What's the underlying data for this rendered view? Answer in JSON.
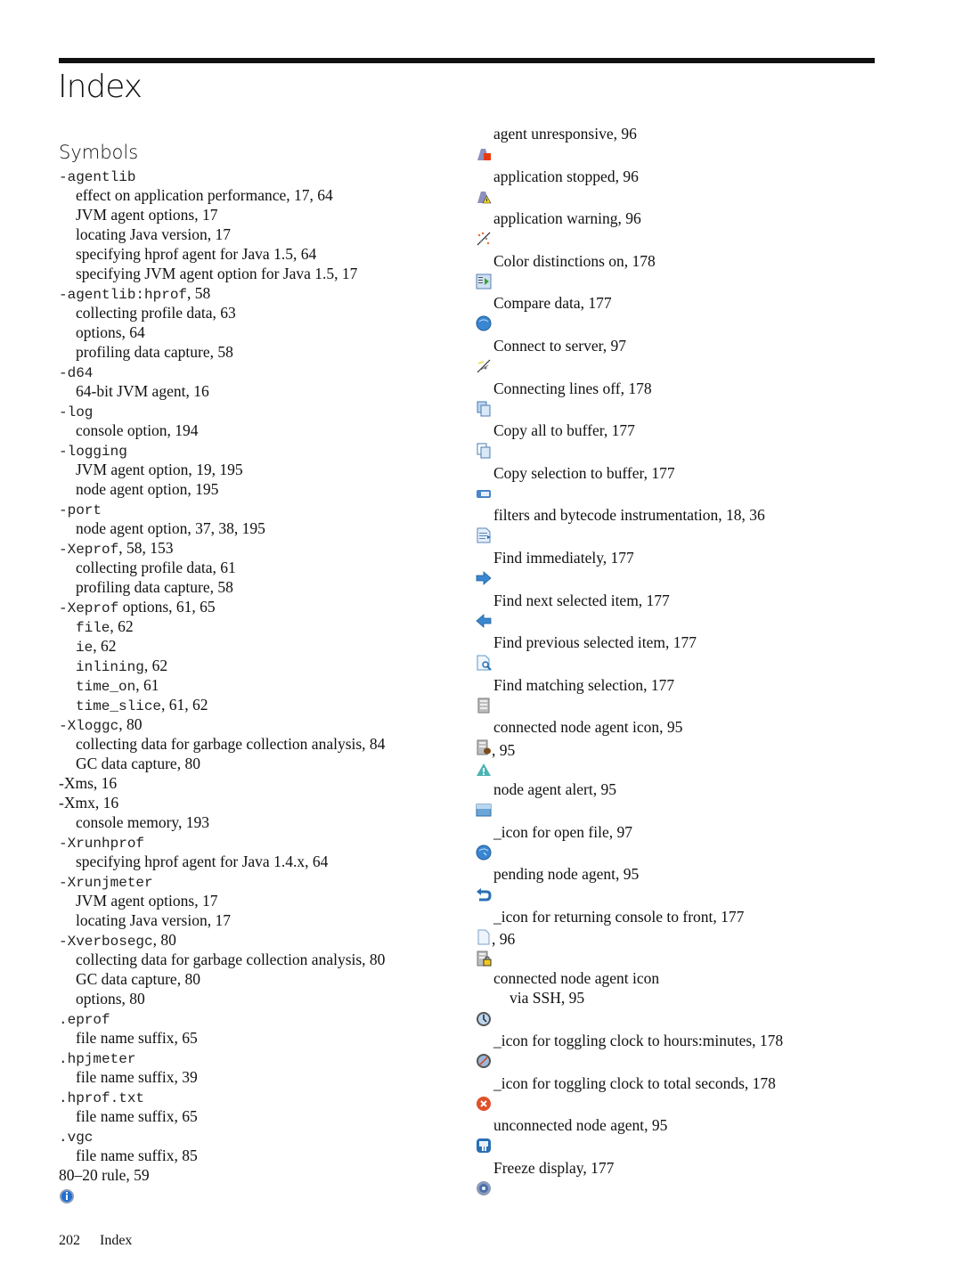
{
  "page": {
    "title": "Index",
    "footer": {
      "page_number": "202",
      "section": "Index"
    }
  },
  "left_column": {
    "section_heading": "Symbols",
    "entries": [
      {
        "term": "-agentlib",
        "mono": true,
        "refs": "",
        "level": 0
      },
      {
        "term": "effect on application performance, 17, 64",
        "level": 1
      },
      {
        "term": "JVM agent options, 17",
        "level": 1
      },
      {
        "term": "locating Java version, 17",
        "level": 1
      },
      {
        "term": "specifying hprof agent for Java 1.5, 64",
        "level": 1
      },
      {
        "term": "specifying JVM agent option for Java 1.5, 17",
        "level": 1
      },
      {
        "term": "-agentlib:hprof",
        "mono": true,
        "refs": ", 58",
        "level": 0
      },
      {
        "term": "collecting profile data, 63",
        "level": 1
      },
      {
        "term": "options, 64",
        "level": 1
      },
      {
        "term": "profiling data capture, 58",
        "level": 1
      },
      {
        "term": "-d64",
        "mono": true,
        "refs": "",
        "level": 0
      },
      {
        "term": "64-bit JVM agent, 16",
        "level": 1
      },
      {
        "term": "-log",
        "mono": true,
        "refs": "",
        "level": 0
      },
      {
        "term": "console option, 194",
        "level": 1
      },
      {
        "term": "-logging",
        "mono": true,
        "refs": "",
        "level": 0
      },
      {
        "term": "JVM agent option, 19, 195",
        "level": 1
      },
      {
        "term": "node agent option, 195",
        "level": 1
      },
      {
        "term": "-port",
        "mono": true,
        "refs": "",
        "level": 0
      },
      {
        "term": "node agent option, 37, 38, 195",
        "level": 1
      },
      {
        "term": "-Xeprof",
        "mono": true,
        "refs": ", 58, 153",
        "level": 0
      },
      {
        "term": "collecting profile data, 61",
        "level": 1
      },
      {
        "term": "profiling data capture, 58",
        "level": 1
      },
      {
        "term": "-Xeprof",
        "mono": true,
        "refs": " options, 61, 65",
        "level": 0
      },
      {
        "term": "file",
        "mono": true,
        "refs": ", 62",
        "level": 1
      },
      {
        "term": "ie",
        "mono": true,
        "refs": ", 62",
        "level": 1
      },
      {
        "term": "inlining",
        "mono": true,
        "refs": ", 62",
        "level": 1
      },
      {
        "term": "time_on",
        "mono": true,
        "refs": ", 61",
        "level": 1
      },
      {
        "term": "time_slice",
        "mono": true,
        "refs": ", 61, 62",
        "level": 1
      },
      {
        "term": "-Xloggc",
        "mono": true,
        "refs": ", 80",
        "level": 0
      },
      {
        "term": "collecting data for garbage collection analysis, 84",
        "level": 1
      },
      {
        "term": "GC data capture, 80",
        "level": 1
      },
      {
        "term": "-Xms, 16",
        "level": 0
      },
      {
        "term": "-Xmx, 16",
        "level": 0
      },
      {
        "term": "console memory, 193",
        "level": 1
      },
      {
        "term": "-Xrunhprof",
        "mono": true,
        "refs": "",
        "level": 0
      },
      {
        "term": "specifying hprof agent for Java 1.4.x, 64",
        "level": 1
      },
      {
        "term": "-Xrunjmeter",
        "mono": true,
        "refs": "",
        "level": 0
      },
      {
        "term": "JVM agent options, 17",
        "level": 1
      },
      {
        "term": "locating Java version, 17",
        "level": 1
      },
      {
        "term": "-Xverbosegc",
        "mono": true,
        "refs": ", 80",
        "level": 0
      },
      {
        "term": "collecting data for garbage collection analysis, 80",
        "level": 1
      },
      {
        "term": "GC data capture, 80",
        "level": 1
      },
      {
        "term": "options, 80",
        "level": 1
      },
      {
        "term": ".eprof",
        "mono": true,
        "refs": "",
        "level": 0
      },
      {
        "term": "file name suffix, 65",
        "level": 1
      },
      {
        "term": ".hpjmeter",
        "mono": true,
        "refs": "",
        "level": 0
      },
      {
        "term": "file name suffix, 39",
        "level": 1
      },
      {
        "term": ".hprof.txt",
        "mono": true,
        "refs": "",
        "level": 0
      },
      {
        "term": "file name suffix, 65",
        "level": 1
      },
      {
        "term": ".vgc",
        "mono": true,
        "refs": "",
        "level": 0
      },
      {
        "term": "file name suffix, 85",
        "level": 1
      },
      {
        "term": "80–20 rule, 59",
        "level": 0
      }
    ],
    "trailing_icon": "gear-info-icon"
  },
  "right_column": {
    "items": [
      {
        "text": "agent unresponsive, 96",
        "icon": "agent-stopped-icon"
      },
      {
        "text": "application stopped, 96",
        "icon": "application-warning-icon"
      },
      {
        "text": "application warning, 96",
        "icon": "color-distinctions-icon"
      },
      {
        "text": "Color distinctions on, 178",
        "icon": "compare-data-icon"
      },
      {
        "text": "Compare data, 177",
        "icon": "globe-icon"
      },
      {
        "text": "Connect to server, 97",
        "icon": "connecting-lines-icon"
      },
      {
        "text": "Connecting lines off, 178",
        "icon": "copy-all-icon"
      },
      {
        "text": "Copy all to buffer, 177",
        "icon": "copy-selection-icon"
      },
      {
        "text": "Copy selection to buffer, 177",
        "icon": "filter-icon"
      },
      {
        "text": "filters and bytecode instrumentation, 18, 36",
        "icon": "find-immediately-icon"
      },
      {
        "text": "Find immediately, 177",
        "icon": "arrow-right-icon"
      },
      {
        "text": "Find next selected item, 177",
        "icon": "arrow-left-icon"
      },
      {
        "text": "Find previous selected item, 177",
        "icon": "find-matching-icon"
      },
      {
        "text": "Find matching selection, 177",
        "icon": "node-agent-icon"
      },
      {
        "text": "connected node agent icon, 95",
        "icon": "node-agent-java-icon",
        "icon_suffix": ", 95"
      },
      {
        "text": "",
        "icon": "node-agent-alert-icon",
        "spacer": true
      },
      {
        "text": "node agent alert, 95",
        "icon": "open-folder-icon"
      },
      {
        "text": "_icon for open file, 97",
        "icon": "pending-globe-icon"
      },
      {
        "text": "pending node agent, 95",
        "icon": "return-arrow-icon"
      },
      {
        "text": "_icon for returning console to front, 177",
        "icon": "blank-page-icon",
        "icon_suffix": ", 96"
      },
      {
        "text": "",
        "icon": "node-agent-lock-icon",
        "spacer": true
      },
      {
        "text": "connected node agent icon",
        "cont": "via SSH, 95",
        "icon": "clock-hours-icon"
      },
      {
        "text": "_icon for toggling clock to hours:minutes, 178",
        "icon": "clock-seconds-icon"
      },
      {
        "text": "_icon for toggling clock to total seconds, 178",
        "icon": "unconnected-x-icon"
      },
      {
        "text": "unconnected node agent, 95",
        "icon": "freeze-display-icon"
      },
      {
        "text": "Freeze display, 177",
        "icon": "gear-settings-icon"
      }
    ]
  },
  "colors": {
    "text": "#111111",
    "rule": "#111111",
    "icon_blue": "#3a7fc0",
    "icon_red": "#e0502a",
    "icon_teal": "#4ab3b3"
  }
}
